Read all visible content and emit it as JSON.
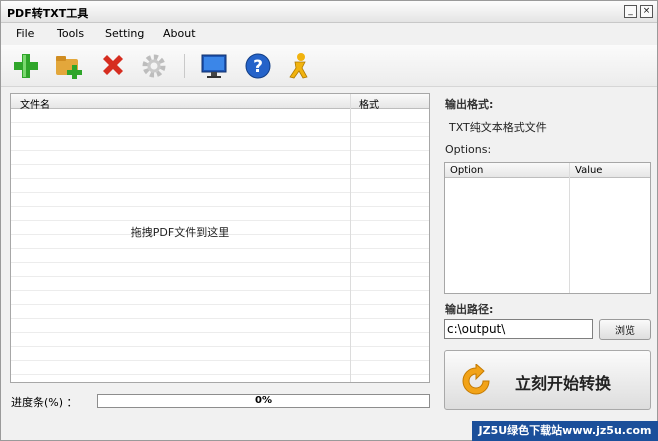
{
  "window": {
    "title": "PDF转TXT工具",
    "minimize_glyph": "_",
    "close_glyph": "×"
  },
  "menu": {
    "items": [
      "File",
      "Tools",
      "Setting",
      "About"
    ]
  },
  "toolbar": {
    "icons": [
      "add-icon",
      "add-folder-icon",
      "delete-icon",
      "settings-icon",
      "monitor-icon",
      "help-icon",
      "aim-icon"
    ]
  },
  "file_list": {
    "columns": [
      "文件名",
      "格式"
    ],
    "drop_hint": "拖拽PDF文件到这里"
  },
  "progress": {
    "label": "进度条(%) ：",
    "value": 0,
    "text": "0%"
  },
  "output_format": {
    "label": "输出格式:",
    "value": "TXT纯文本格式文件"
  },
  "options": {
    "label": "Options:",
    "columns": [
      "Option",
      "Value"
    ]
  },
  "output_path": {
    "label": "输出路径:",
    "value": "c:\\output\\",
    "browse_label": "浏览"
  },
  "convert": {
    "label": "立刻开始转换"
  },
  "watermark": {
    "text": "JZ5U绿色下载站www.jz5u.com"
  },
  "colors": {
    "accent_blue": "#1b4f9a",
    "progress_fill": "#6fa6e6"
  }
}
